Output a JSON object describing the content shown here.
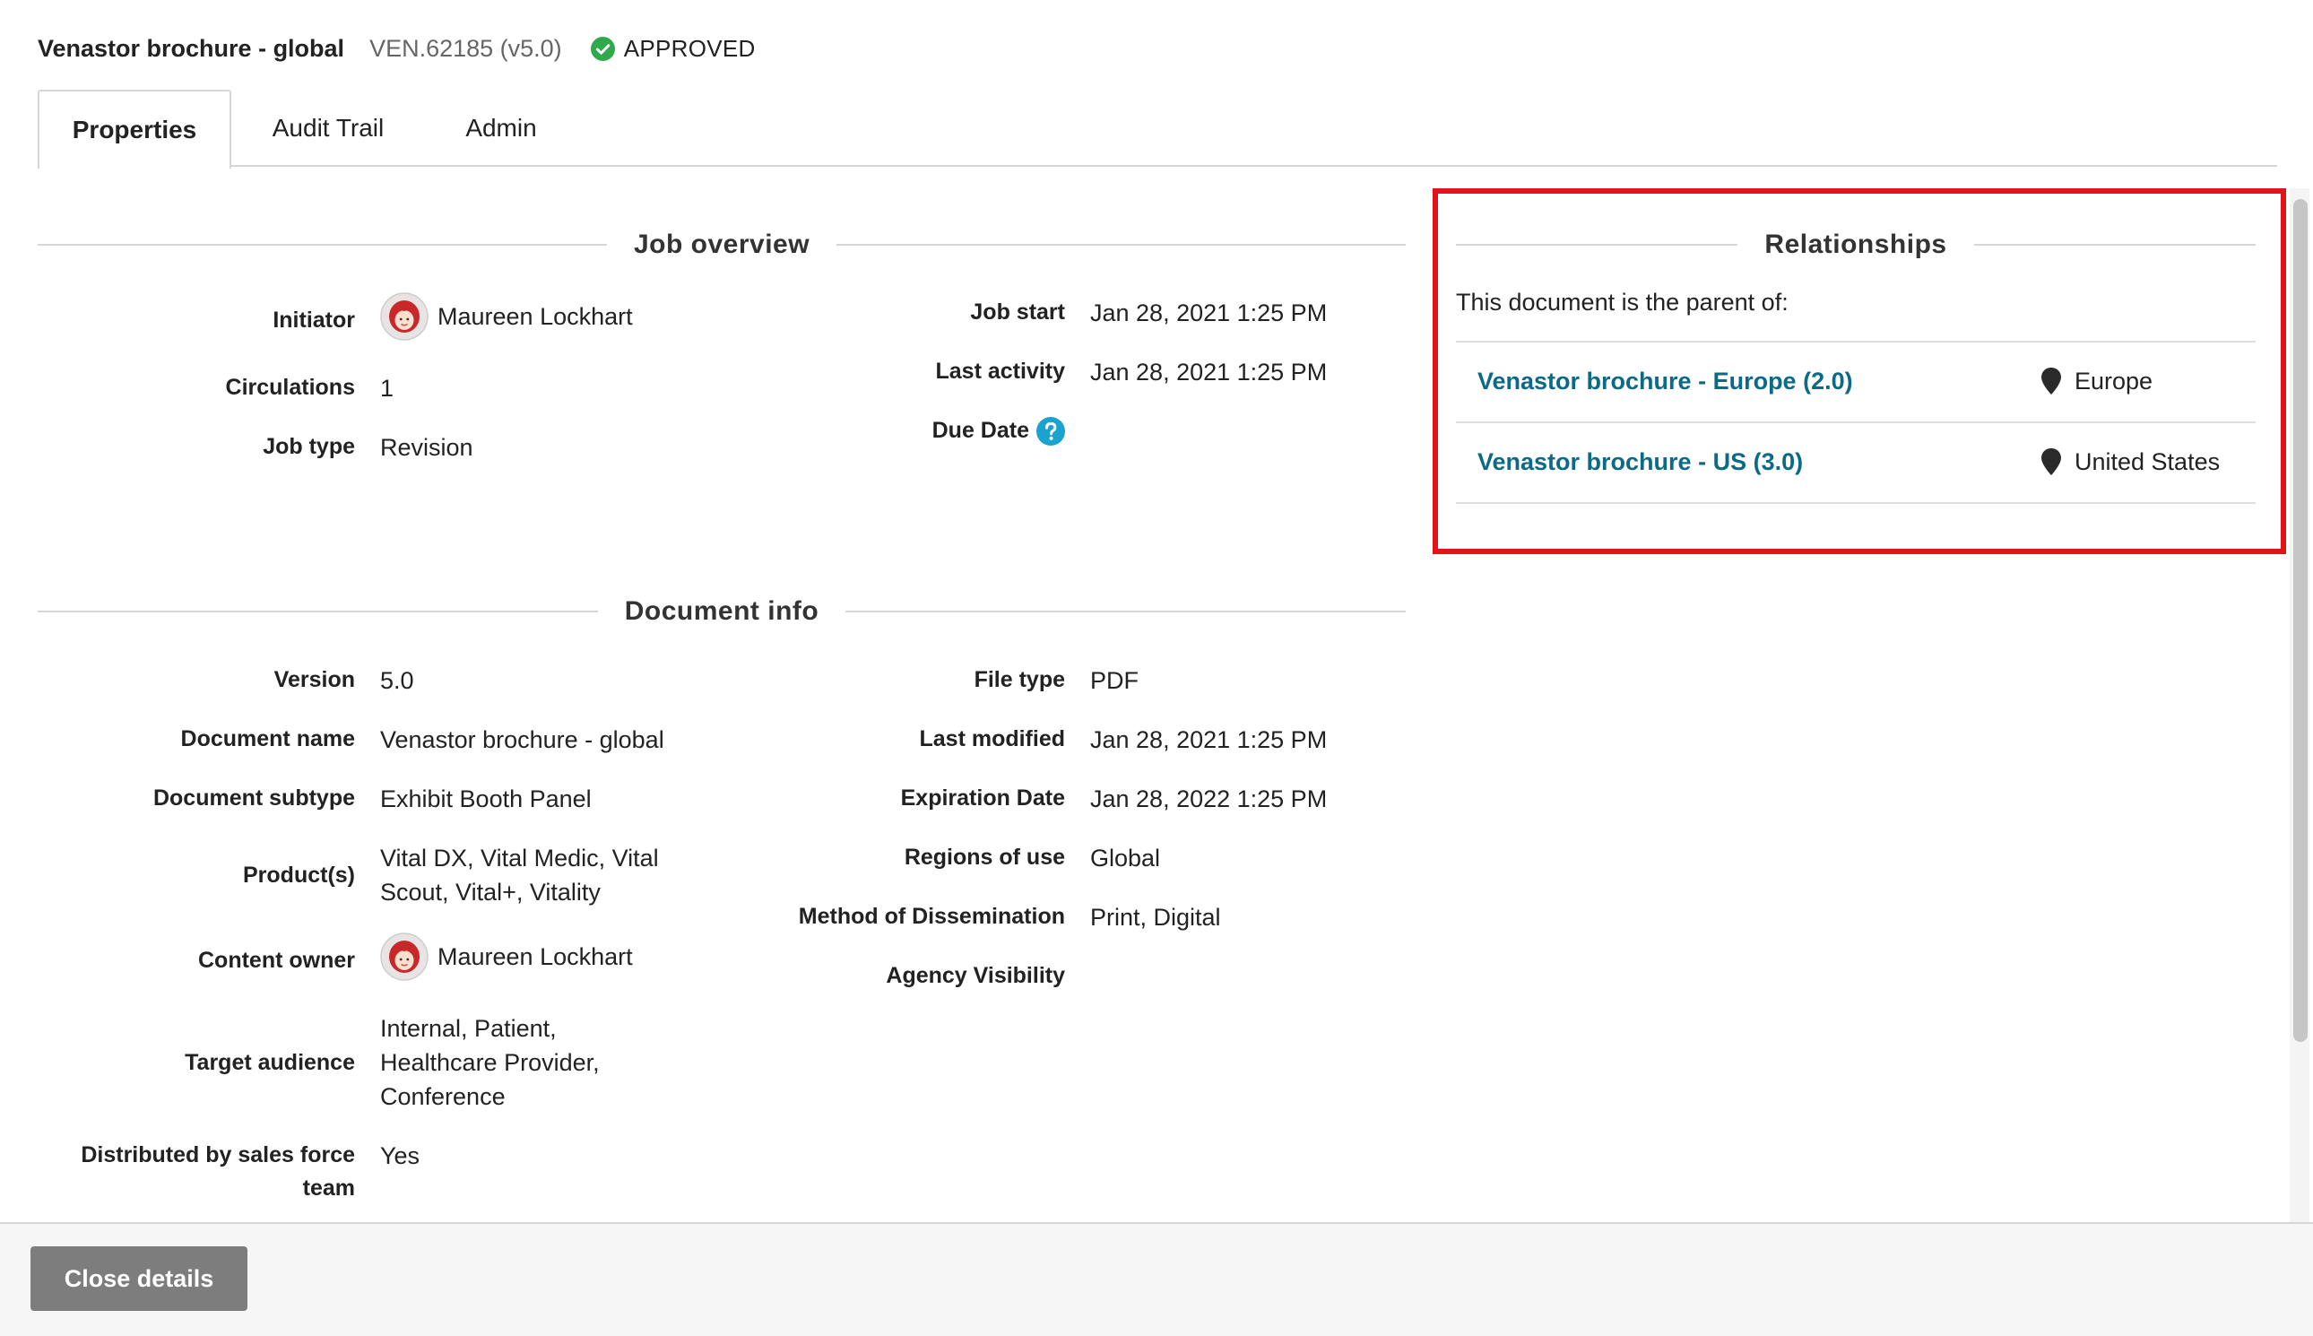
{
  "header": {
    "title": "Venastor brochure - global",
    "doc_id": "VEN.62185 (v5.0)",
    "status": "APPROVED",
    "status_icon": "check-circle-icon",
    "status_color": "#2eaa4a"
  },
  "tabs": [
    {
      "label": "Properties",
      "active": true
    },
    {
      "label": "Audit Trail",
      "active": false
    },
    {
      "label": "Admin",
      "active": false
    }
  ],
  "job_overview": {
    "title": "Job overview",
    "left": [
      {
        "label": "Initiator",
        "value": "Maureen Lockhart",
        "avatar": true
      },
      {
        "label": "Circulations",
        "value": "1"
      },
      {
        "label": "Job type",
        "value": "Revision"
      }
    ],
    "right": [
      {
        "label": "Job start",
        "value": "Jan 28, 2021 1:25 PM"
      },
      {
        "label": "Last activity",
        "value": "Jan 28, 2021 1:25 PM"
      },
      {
        "label": "Due Date",
        "value": "",
        "help_icon": "question-circle-icon"
      }
    ]
  },
  "document_info": {
    "title": "Document info",
    "left": [
      {
        "label": "Version",
        "value": "5.0"
      },
      {
        "label": "Document name",
        "value": "Venastor brochure - global"
      },
      {
        "label": "Document subtype",
        "value": "Exhibit Booth Panel"
      },
      {
        "label": "Product(s)",
        "value_lines": [
          "Vital DX, Vital Medic, Vital",
          "Scout, Vital+, Vitality"
        ]
      },
      {
        "label": "Content owner",
        "value": "Maureen Lockhart",
        "avatar": true
      },
      {
        "label": "Target audience",
        "value_lines": [
          "Internal, Patient,",
          "Healthcare Provider,",
          "Conference"
        ]
      },
      {
        "label_lines": [
          "Distributed by sales force",
          "team"
        ],
        "value": "Yes"
      }
    ],
    "right": [
      {
        "label": "File type",
        "value": "PDF"
      },
      {
        "label": "Last modified",
        "value": "Jan 28, 2021 1:25 PM"
      },
      {
        "label": "Expiration Date",
        "value": "Jan 28, 2022 1:25 PM"
      },
      {
        "label": "Regions of use",
        "value": "Global"
      },
      {
        "label": "Method of Dissemination",
        "value": "Print, Digital"
      },
      {
        "label": "Agency Visibility",
        "value": ""
      }
    ]
  },
  "relationships": {
    "title": "Relationships",
    "intro": "This document is the parent of:",
    "items": [
      {
        "name": "Venastor brochure - Europe (2.0)",
        "region": "Europe"
      },
      {
        "name": "Venastor brochure - US (3.0)",
        "region": "United States"
      }
    ],
    "link_color": "#0b6a86",
    "highlight_color": "#e2141a"
  },
  "footer": {
    "close_label": "Close details"
  }
}
